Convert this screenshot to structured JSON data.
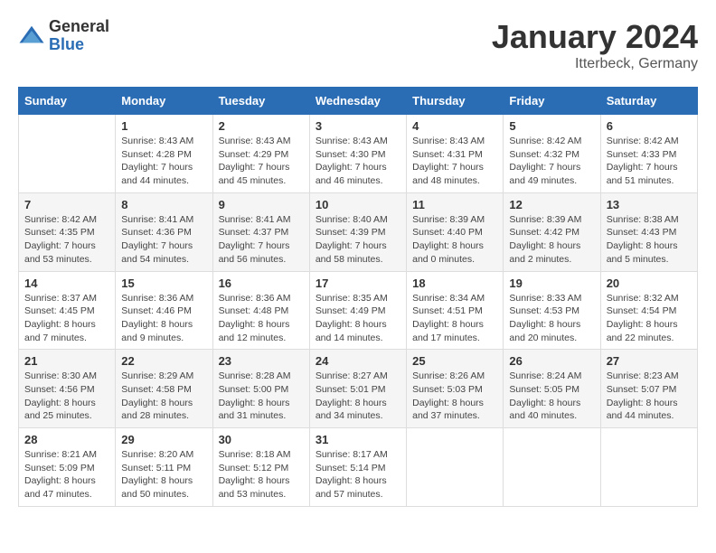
{
  "header": {
    "logo_general": "General",
    "logo_blue": "Blue",
    "month_title": "January 2024",
    "subtitle": "Itterbeck, Germany"
  },
  "days_of_week": [
    "Sunday",
    "Monday",
    "Tuesday",
    "Wednesday",
    "Thursday",
    "Friday",
    "Saturday"
  ],
  "weeks": [
    [
      {
        "day": "",
        "info": ""
      },
      {
        "day": "1",
        "info": "Sunrise: 8:43 AM\nSunset: 4:28 PM\nDaylight: 7 hours\nand 44 minutes."
      },
      {
        "day": "2",
        "info": "Sunrise: 8:43 AM\nSunset: 4:29 PM\nDaylight: 7 hours\nand 45 minutes."
      },
      {
        "day": "3",
        "info": "Sunrise: 8:43 AM\nSunset: 4:30 PM\nDaylight: 7 hours\nand 46 minutes."
      },
      {
        "day": "4",
        "info": "Sunrise: 8:43 AM\nSunset: 4:31 PM\nDaylight: 7 hours\nand 48 minutes."
      },
      {
        "day": "5",
        "info": "Sunrise: 8:42 AM\nSunset: 4:32 PM\nDaylight: 7 hours\nand 49 minutes."
      },
      {
        "day": "6",
        "info": "Sunrise: 8:42 AM\nSunset: 4:33 PM\nDaylight: 7 hours\nand 51 minutes."
      }
    ],
    [
      {
        "day": "7",
        "info": "Sunrise: 8:42 AM\nSunset: 4:35 PM\nDaylight: 7 hours\nand 53 minutes."
      },
      {
        "day": "8",
        "info": "Sunrise: 8:41 AM\nSunset: 4:36 PM\nDaylight: 7 hours\nand 54 minutes."
      },
      {
        "day": "9",
        "info": "Sunrise: 8:41 AM\nSunset: 4:37 PM\nDaylight: 7 hours\nand 56 minutes."
      },
      {
        "day": "10",
        "info": "Sunrise: 8:40 AM\nSunset: 4:39 PM\nDaylight: 7 hours\nand 58 minutes."
      },
      {
        "day": "11",
        "info": "Sunrise: 8:39 AM\nSunset: 4:40 PM\nDaylight: 8 hours\nand 0 minutes."
      },
      {
        "day": "12",
        "info": "Sunrise: 8:39 AM\nSunset: 4:42 PM\nDaylight: 8 hours\nand 2 minutes."
      },
      {
        "day": "13",
        "info": "Sunrise: 8:38 AM\nSunset: 4:43 PM\nDaylight: 8 hours\nand 5 minutes."
      }
    ],
    [
      {
        "day": "14",
        "info": "Sunrise: 8:37 AM\nSunset: 4:45 PM\nDaylight: 8 hours\nand 7 minutes."
      },
      {
        "day": "15",
        "info": "Sunrise: 8:36 AM\nSunset: 4:46 PM\nDaylight: 8 hours\nand 9 minutes."
      },
      {
        "day": "16",
        "info": "Sunrise: 8:36 AM\nSunset: 4:48 PM\nDaylight: 8 hours\nand 12 minutes."
      },
      {
        "day": "17",
        "info": "Sunrise: 8:35 AM\nSunset: 4:49 PM\nDaylight: 8 hours\nand 14 minutes."
      },
      {
        "day": "18",
        "info": "Sunrise: 8:34 AM\nSunset: 4:51 PM\nDaylight: 8 hours\nand 17 minutes."
      },
      {
        "day": "19",
        "info": "Sunrise: 8:33 AM\nSunset: 4:53 PM\nDaylight: 8 hours\nand 20 minutes."
      },
      {
        "day": "20",
        "info": "Sunrise: 8:32 AM\nSunset: 4:54 PM\nDaylight: 8 hours\nand 22 minutes."
      }
    ],
    [
      {
        "day": "21",
        "info": "Sunrise: 8:30 AM\nSunset: 4:56 PM\nDaylight: 8 hours\nand 25 minutes."
      },
      {
        "day": "22",
        "info": "Sunrise: 8:29 AM\nSunset: 4:58 PM\nDaylight: 8 hours\nand 28 minutes."
      },
      {
        "day": "23",
        "info": "Sunrise: 8:28 AM\nSunset: 5:00 PM\nDaylight: 8 hours\nand 31 minutes."
      },
      {
        "day": "24",
        "info": "Sunrise: 8:27 AM\nSunset: 5:01 PM\nDaylight: 8 hours\nand 34 minutes."
      },
      {
        "day": "25",
        "info": "Sunrise: 8:26 AM\nSunset: 5:03 PM\nDaylight: 8 hours\nand 37 minutes."
      },
      {
        "day": "26",
        "info": "Sunrise: 8:24 AM\nSunset: 5:05 PM\nDaylight: 8 hours\nand 40 minutes."
      },
      {
        "day": "27",
        "info": "Sunrise: 8:23 AM\nSunset: 5:07 PM\nDaylight: 8 hours\nand 44 minutes."
      }
    ],
    [
      {
        "day": "28",
        "info": "Sunrise: 8:21 AM\nSunset: 5:09 PM\nDaylight: 8 hours\nand 47 minutes."
      },
      {
        "day": "29",
        "info": "Sunrise: 8:20 AM\nSunset: 5:11 PM\nDaylight: 8 hours\nand 50 minutes."
      },
      {
        "day": "30",
        "info": "Sunrise: 8:18 AM\nSunset: 5:12 PM\nDaylight: 8 hours\nand 53 minutes."
      },
      {
        "day": "31",
        "info": "Sunrise: 8:17 AM\nSunset: 5:14 PM\nDaylight: 8 hours\nand 57 minutes."
      },
      {
        "day": "",
        "info": ""
      },
      {
        "day": "",
        "info": ""
      },
      {
        "day": "",
        "info": ""
      }
    ]
  ]
}
